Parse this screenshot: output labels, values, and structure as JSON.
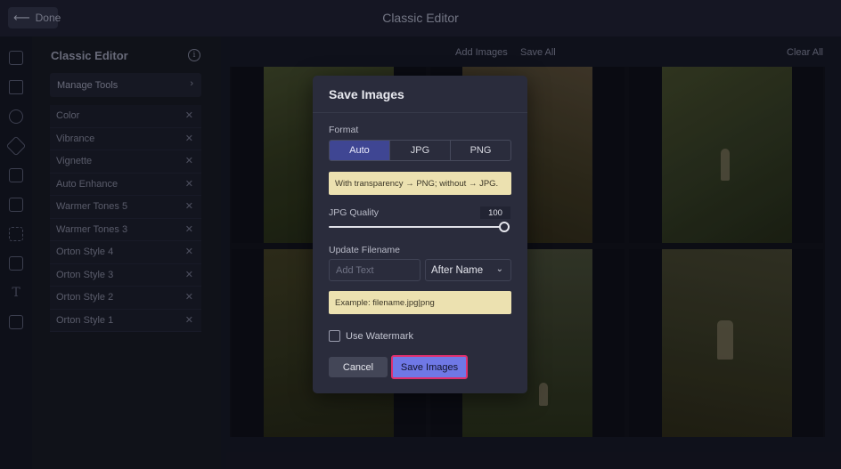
{
  "topbar": {
    "done_label": "Done",
    "title": "Classic Editor"
  },
  "panel": {
    "title": "Classic Editor",
    "manage_tools": "Manage Tools",
    "tools": [
      "Color",
      "Vibrance",
      "Vignette",
      "Auto Enhance",
      "Warmer Tones 5",
      "Warmer Tones 3",
      "Orton Style 4",
      "Orton Style 3",
      "Orton Style 2",
      "Orton Style 1"
    ]
  },
  "toolbar": {
    "add_images": "Add Images",
    "save_all": "Save All",
    "clear_all": "Clear All"
  },
  "modal": {
    "title": "Save Images",
    "format_label": "Format",
    "format_options": [
      "Auto",
      "JPG",
      "PNG"
    ],
    "format_selected": "Auto",
    "format_note": "With transparency → PNG; without → JPG.",
    "quality_label": "JPG Quality",
    "quality_value": "100",
    "quality_fraction": 1.0,
    "filename_label": "Update Filename",
    "filename_placeholder": "Add Text",
    "filename_position": "After Name",
    "example_note": "Example: filename.jpg|png",
    "watermark_label": "Use Watermark",
    "watermark_checked": false,
    "cancel_label": "Cancel",
    "save_label": "Save Images"
  },
  "colors": {
    "accent": "#6f78e6",
    "highlight_border": "#e0306f",
    "note_bg": "#ece1b0",
    "active_segment": "#3f4693"
  },
  "icons": {
    "done": "arrow-left-icon",
    "info": "info-icon",
    "manage_chevron": "chevron-right-icon",
    "remove": "close-icon",
    "select": "chevron-down-icon"
  }
}
